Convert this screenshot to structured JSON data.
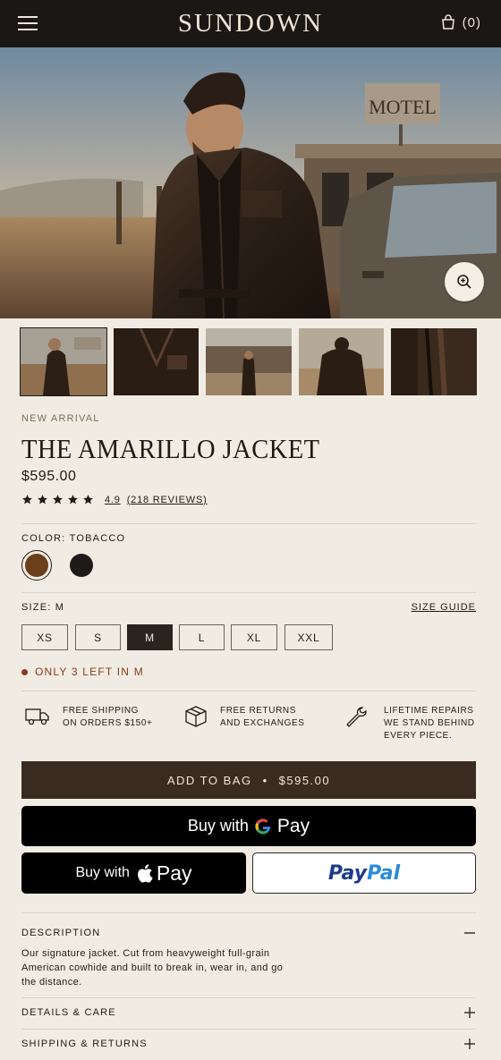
{
  "header": {
    "logo": "SUNDOWN",
    "bag_count": "(0)"
  },
  "hero": {
    "sign": "MOTEL"
  },
  "product": {
    "eyebrow": "NEW ARRIVAL",
    "title": "THE AMARILLO JACKET",
    "price": "$595.00",
    "rating": {
      "stars": 5,
      "score": "4.9",
      "reviews": "(218 REVIEWS)"
    }
  },
  "color": {
    "label": "COLOR:",
    "selected": "TOBACCO",
    "options": [
      {
        "name": "tobacco",
        "hex": "#6b3f1b",
        "selected": true
      },
      {
        "name": "black",
        "hex": "#1e1c1a",
        "selected": false
      }
    ]
  },
  "size": {
    "label": "SIZE:",
    "selected": "M",
    "guide": "SIZE GUIDE",
    "options": [
      "XS",
      "S",
      "M",
      "L",
      "XL",
      "XXL"
    ]
  },
  "stock": {
    "text": "ONLY 3 LEFT IN M",
    "color": "#8a3a1c"
  },
  "features": [
    {
      "icon": "truck-icon",
      "line1": "FREE SHIPPING",
      "line2": "ON ORDERS $150+",
      "line3": ""
    },
    {
      "icon": "box-icon",
      "line1": "FREE RETURNS",
      "line2": "AND EXCHANGES",
      "line3": ""
    },
    {
      "icon": "wrench-icon",
      "line1": "LIFETIME REPAIRS",
      "line2": "WE STAND BEHIND",
      "line3": "EVERY PIECE."
    }
  ],
  "actions": {
    "add_to_bag": "ADD TO BAG",
    "add_to_bag_price": "$595.00",
    "gpay_buy": "Buy with",
    "gpay_pay": "Pay",
    "applepay_buy": "Buy with",
    "applepay_pay": "Pay",
    "paypal_1": "Pay",
    "paypal_2": "Pal"
  },
  "accordion": {
    "description": {
      "title": "DESCRIPTION",
      "body": "Our signature jacket. Cut from heavyweight full-grain American cowhide and built to break in, wear in, and go the distance."
    },
    "details": {
      "title": "DETAILS & CARE"
    },
    "shipping": {
      "title": "SHIPPING & RETURNS"
    }
  },
  "colors": {
    "header_bg": "#1b1714",
    "page_bg": "#f1ece3",
    "button_brown": "#3a2b20"
  }
}
